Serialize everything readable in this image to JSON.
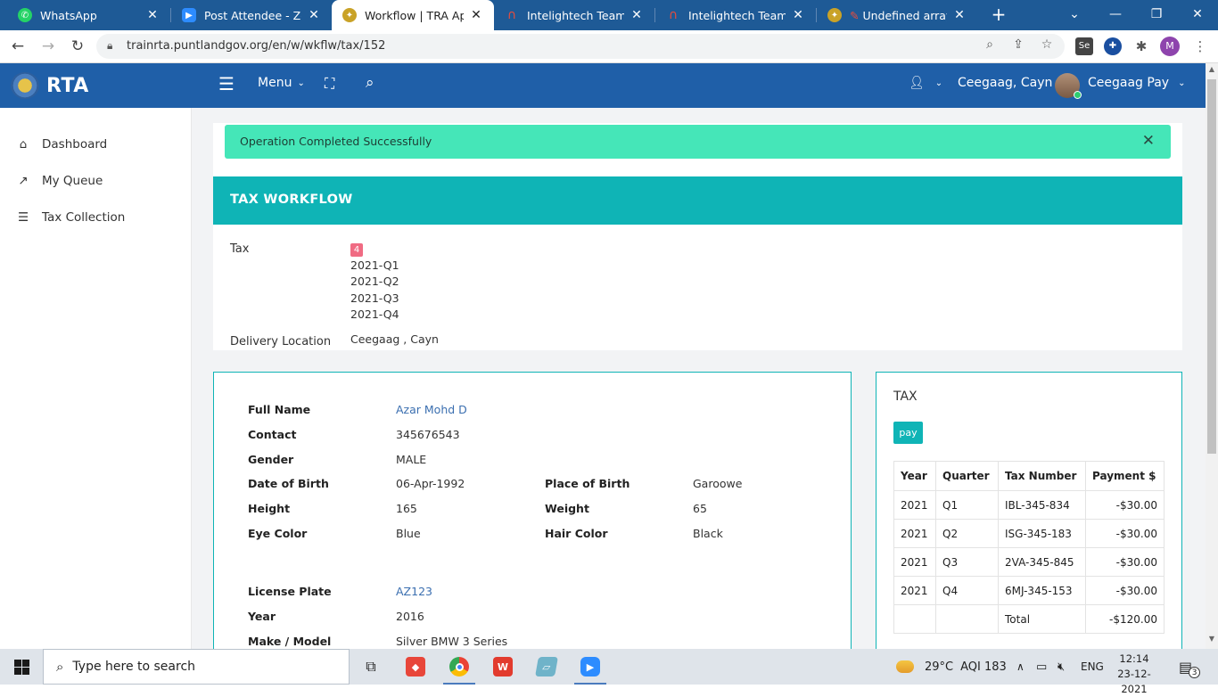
{
  "browser": {
    "tabs": [
      {
        "title": "WhatsApp",
        "icon": "whatsapp-icon",
        "color": "#25d366",
        "active": false
      },
      {
        "title": "Post Attendee - Zoom",
        "icon": "zoom-icon",
        "color": "#2d8cff",
        "active": false
      },
      {
        "title": "Workflow | TRA App",
        "icon": "emblem-icon",
        "color": "#c9a227",
        "active": true
      },
      {
        "title": "Intelightech Teams Po",
        "icon": "headset-icon",
        "color": "#c0392b",
        "active": false
      },
      {
        "title": "Intelightech Teams Po",
        "icon": "headset-icon",
        "color": "#c0392b",
        "active": false
      },
      {
        "title": "Undefined array ke",
        "icon": "emblem-icon",
        "color": "#c9a227",
        "active": false
      }
    ],
    "url": "trainrta.puntlandgov.org/en/w/wkflw/tax/152",
    "profile_initial": "M"
  },
  "header": {
    "brand": "RTA",
    "menu_label": "Menu",
    "location_user": "Ceegaag, Cayn",
    "user_name": "Ceegaag Pay",
    "color": "#1f5fa8"
  },
  "sidebar": {
    "items": [
      {
        "label": "Dashboard",
        "icon": "home-icon"
      },
      {
        "label": "My Queue",
        "icon": "trend-icon"
      },
      {
        "label": "Tax Collection",
        "icon": "list-icon"
      }
    ]
  },
  "alert": {
    "message": "Operation Completed Successfully",
    "color": "#45e6b8"
  },
  "workflow": {
    "title": "TAX WORKFLOW",
    "tax_label": "Tax",
    "tax_count": "4",
    "periods": [
      "2021-Q1",
      "2021-Q2",
      "2021-Q3",
      "2021-Q4"
    ],
    "delivery_label": "Delivery Location",
    "delivery_value": "Ceegaag , Cayn",
    "accent": "#0fb4b6"
  },
  "person": {
    "full_name_label": "Full Name",
    "full_name": "Azar Mohd D",
    "contact_label": "Contact",
    "contact": "345676543",
    "gender_label": "Gender",
    "gender": "MALE",
    "dob_label": "Date of Birth",
    "dob": "06-Apr-1992",
    "pob_label": "Place of Birth",
    "pob": "Garoowe",
    "height_label": "Height",
    "height": "165",
    "weight_label": "Weight",
    "weight": "65",
    "eye_label": "Eye Color",
    "eye": "Blue",
    "hair_label": "Hair Color",
    "hair": "Black",
    "plate_label": "License Plate",
    "plate": "AZ123",
    "year_label": "Year",
    "year": "2016",
    "make_label": "Make / Model",
    "make": "Silver BMW 3 Series"
  },
  "tax": {
    "title": "TAX",
    "pay_label": "pay",
    "columns": [
      "Year",
      "Quarter",
      "Tax Number",
      "Payment $"
    ],
    "rows": [
      {
        "year": "2021",
        "quarter": "Q1",
        "number": "IBL-345-834",
        "payment": "-$30.00"
      },
      {
        "year": "2021",
        "quarter": "Q2",
        "number": "ISG-345-183",
        "payment": "-$30.00"
      },
      {
        "year": "2021",
        "quarter": "Q3",
        "number": "2VA-345-845",
        "payment": "-$30.00"
      },
      {
        "year": "2021",
        "quarter": "Q4",
        "number": "6MJ-345-153",
        "payment": "-$30.00"
      }
    ],
    "total_label": "Total",
    "total": "-$120.00"
  },
  "taskbar": {
    "search_placeholder": "Type here to search",
    "weather": "29°C",
    "aqi": "AQI 183",
    "lang": "ENG",
    "time": "12:14",
    "date": "23-12-2021",
    "notifications": "3"
  }
}
